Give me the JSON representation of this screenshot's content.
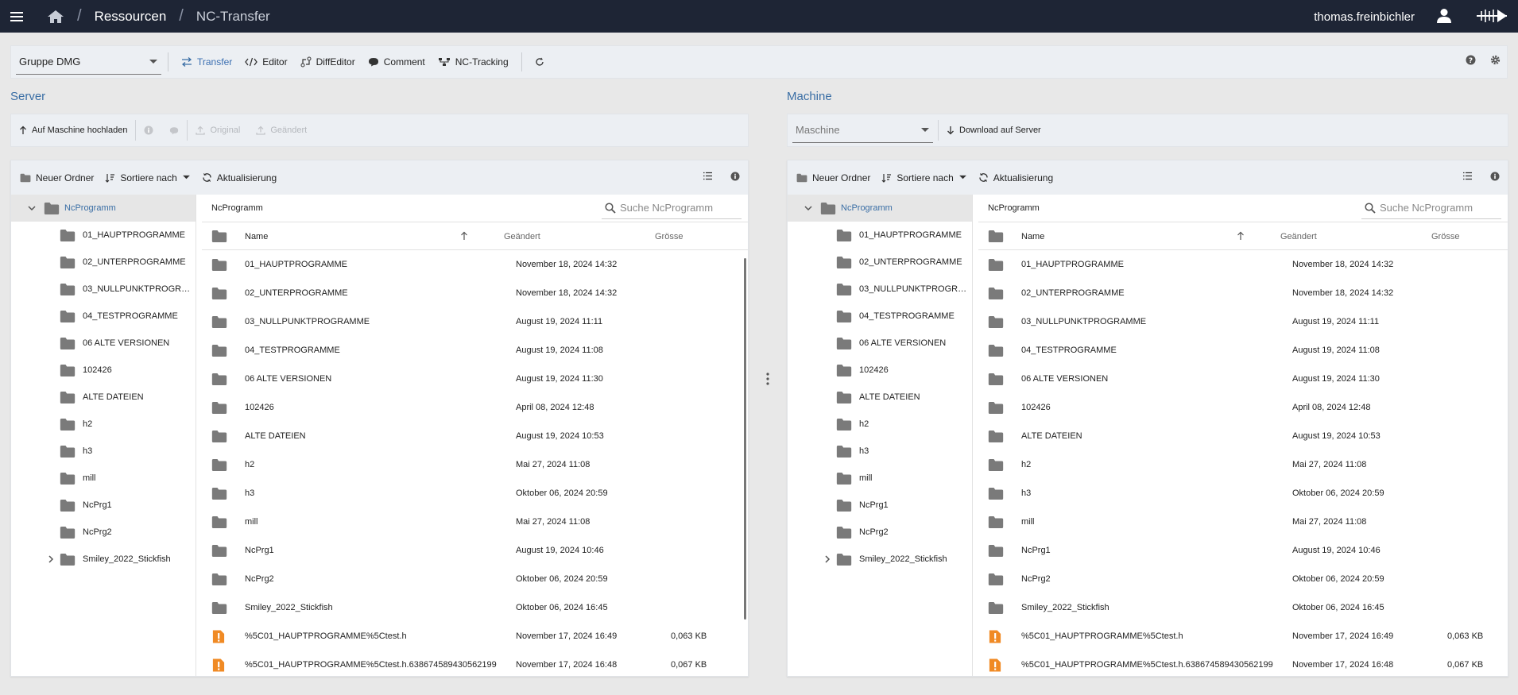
{
  "topbar": {
    "breadcrumb": [
      "Ressourcen",
      "NC-Transfer"
    ],
    "user": "thomas.freinbichler"
  },
  "toolbar": {
    "group": "Gruppe DMG",
    "buttons": [
      "Transfer",
      "Editor",
      "DiffEditor",
      "Comment",
      "NC-Tracking"
    ]
  },
  "server": {
    "title": "Server",
    "actions": {
      "upload": "Auf Maschine hochladen",
      "original": "Original",
      "changed": "Geändert"
    }
  },
  "machine": {
    "title": "Machine",
    "select_placeholder": "Maschine",
    "download": "Download auf Server"
  },
  "explorer": {
    "new_folder": "Neuer Ordner",
    "sort_by": "Sortiere nach",
    "refresh": "Aktualisierung",
    "root": "NcProgramm",
    "path": "NcProgramm",
    "search_placeholder": "Suche NcProgramm",
    "col_name": "Name",
    "col_changed": "Geändert",
    "col_size": "Grösse"
  },
  "tree": [
    "01_HAUPTPROGRAMME",
    "02_UNTERPROGRAMME",
    "03_NULLPUNKTPROGRAMME",
    "04_TESTPROGRAMME",
    "06 ALTE VERSIONEN",
    "102426",
    "ALTE DATEIEN",
    "h2",
    "h3",
    "mill",
    "NcPrg1",
    "NcPrg2",
    "Smiley_2022_Stickfish"
  ],
  "tree_truncated": {
    "server": "03_NULLPUNKTPROGRAMM...",
    "machine": "03_NULLPUNKTPROGRAM..."
  },
  "files": [
    {
      "name": "01_HAUPTPROGRAMME",
      "date": "November 18, 2024 14:32",
      "size": "",
      "type": "folder"
    },
    {
      "name": "02_UNTERPROGRAMME",
      "date": "November 18, 2024 14:32",
      "size": "",
      "type": "folder"
    },
    {
      "name": "03_NULLPUNKTPROGRAMME",
      "date": "August 19, 2024 11:11",
      "size": "",
      "type": "folder"
    },
    {
      "name": "04_TESTPROGRAMME",
      "date": "August 19, 2024 11:08",
      "size": "",
      "type": "folder"
    },
    {
      "name": "06 ALTE VERSIONEN",
      "date": "August 19, 2024 11:30",
      "size": "",
      "type": "folder"
    },
    {
      "name": "102426",
      "date": "April 08, 2024 12:48",
      "size": "",
      "type": "folder"
    },
    {
      "name": "ALTE DATEIEN",
      "date": "August 19, 2024 10:53",
      "size": "",
      "type": "folder"
    },
    {
      "name": "h2",
      "date": "Mai 27, 2024 11:08",
      "size": "",
      "type": "folder"
    },
    {
      "name": "h3",
      "date": "Oktober 06, 2024 20:59",
      "size": "",
      "type": "folder"
    },
    {
      "name": "mill",
      "date": "Mai 27, 2024 11:08",
      "size": "",
      "type": "folder"
    },
    {
      "name": "NcPrg1",
      "date": "August 19, 2024 10:46",
      "size": "",
      "type": "folder"
    },
    {
      "name": "NcPrg2",
      "date": "Oktober 06, 2024 20:59",
      "size": "",
      "type": "folder"
    },
    {
      "name": "Smiley_2022_Stickfish",
      "date": "Oktober 06, 2024 16:45",
      "size": "",
      "type": "folder"
    },
    {
      "name": "%5C01_HAUPTPROGRAMME%5Ctest.h",
      "date": "November 17, 2024 16:49",
      "size": "0,063 KB",
      "type": "file"
    },
    {
      "name": "%5C01_HAUPTPROGRAMME%5Ctest.h.638674589430562199",
      "date": "November 17, 2024 16:48",
      "size": "0,067 KB",
      "type": "file"
    }
  ],
  "colors": {
    "accent": "#3a6ea5",
    "topbar": "#1e2535",
    "folder": "#7a7a7a",
    "file": "#f08a24"
  }
}
